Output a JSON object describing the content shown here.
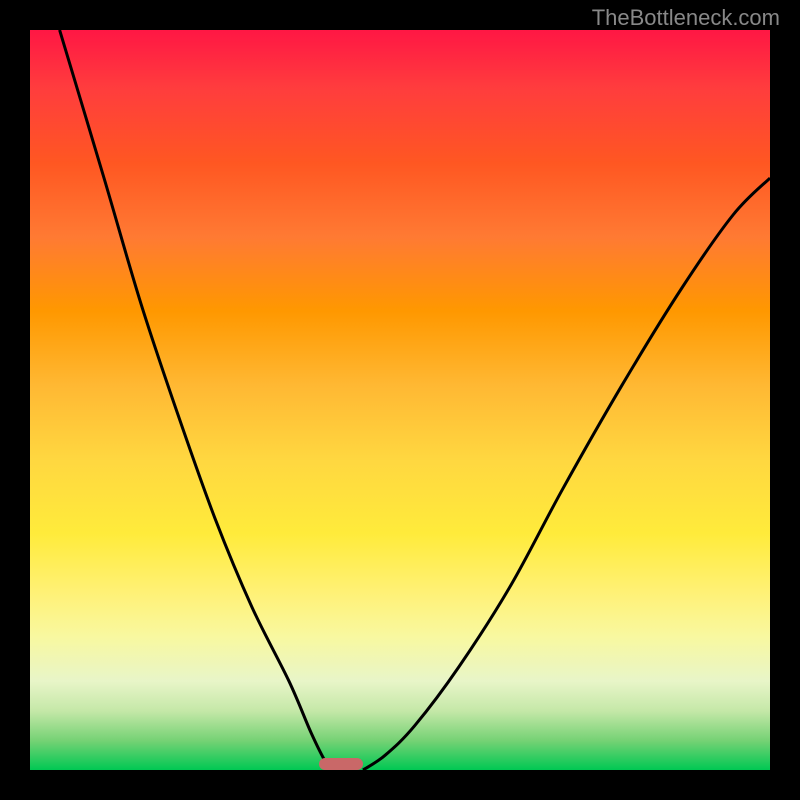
{
  "watermark": "TheBottleneck.com",
  "chart_data": {
    "type": "line",
    "title": "",
    "xlabel": "",
    "ylabel": "",
    "xlim": [
      0,
      100
    ],
    "ylim": [
      0,
      100
    ],
    "series": [
      {
        "name": "left-curve",
        "x": [
          4,
          10,
          15,
          20,
          25,
          30,
          35,
          38,
          40,
          41
        ],
        "y": [
          100,
          80,
          63,
          48,
          34,
          22,
          12,
          5,
          1,
          0
        ]
      },
      {
        "name": "right-curve",
        "x": [
          45,
          48,
          52,
          58,
          65,
          72,
          80,
          88,
          95,
          100
        ],
        "y": [
          0,
          2,
          6,
          14,
          25,
          38,
          52,
          65,
          75,
          80
        ]
      }
    ],
    "marker": {
      "x": 42,
      "y": 0,
      "width": 6,
      "color": "#c96868"
    },
    "gradient_colors": {
      "top": "#ff1744",
      "middle": "#ffeb3b",
      "bottom": "#00c853"
    }
  }
}
